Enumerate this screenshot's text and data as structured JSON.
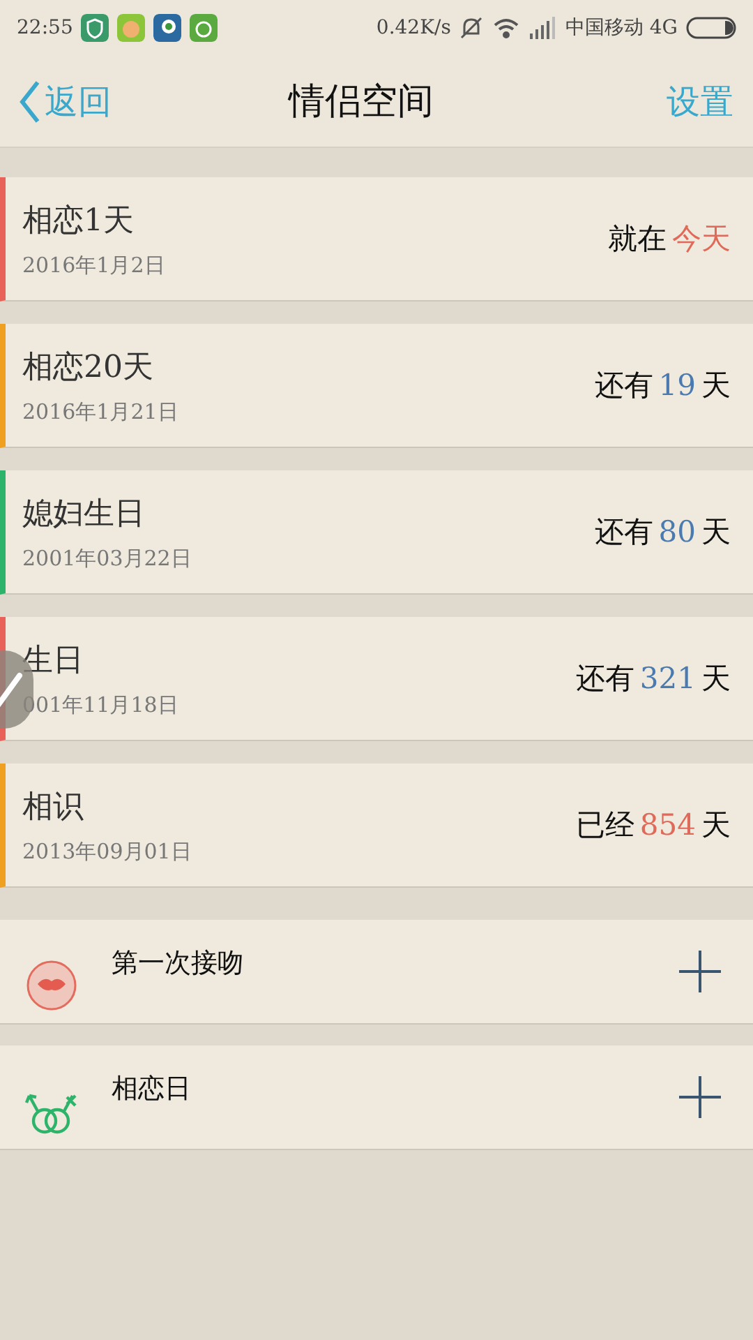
{
  "status_bar": {
    "time": "22:55",
    "speed": "0.42K/s",
    "carrier": "中国移动 4G"
  },
  "header": {
    "back": "返回",
    "title": "情侣空间",
    "action": "设置"
  },
  "events": [
    {
      "title": "相恋1天",
      "date": "2016年1月2日",
      "color": "#e8625a",
      "prefix": "就在",
      "number": {
        "text": "今天",
        "color": "#e06a5a"
      }
    },
    {
      "title": "相恋20天",
      "date": "2016年1月21日",
      "color": "#f0a020",
      "prefix": "还有",
      "number": {
        "text": "19",
        "color": "#4a7ab0"
      },
      "suffix": "天"
    },
    {
      "title": "媳妇生日",
      "date": "2001年03月22日",
      "color": "#2db36a",
      "prefix": "还有",
      "number": {
        "text": "80",
        "color": "#4a7ab0"
      },
      "suffix": "天"
    },
    {
      "title": "生日",
      "date": "001年11月18日",
      "color": "#e8625a",
      "prefix": "还有",
      "number": {
        "text": "321",
        "color": "#4a7ab0"
      },
      "suffix": "天"
    },
    {
      "title": "相识",
      "date": "2013年09月01日",
      "color": "#f0a020",
      "prefix": "已经",
      "number": {
        "text": "854",
        "color": "#e06a5a"
      },
      "suffix": "天"
    }
  ],
  "add_items": [
    {
      "kind": "kiss",
      "label": "第一次接吻"
    },
    {
      "kind": "couple",
      "label": "相恋日"
    }
  ]
}
